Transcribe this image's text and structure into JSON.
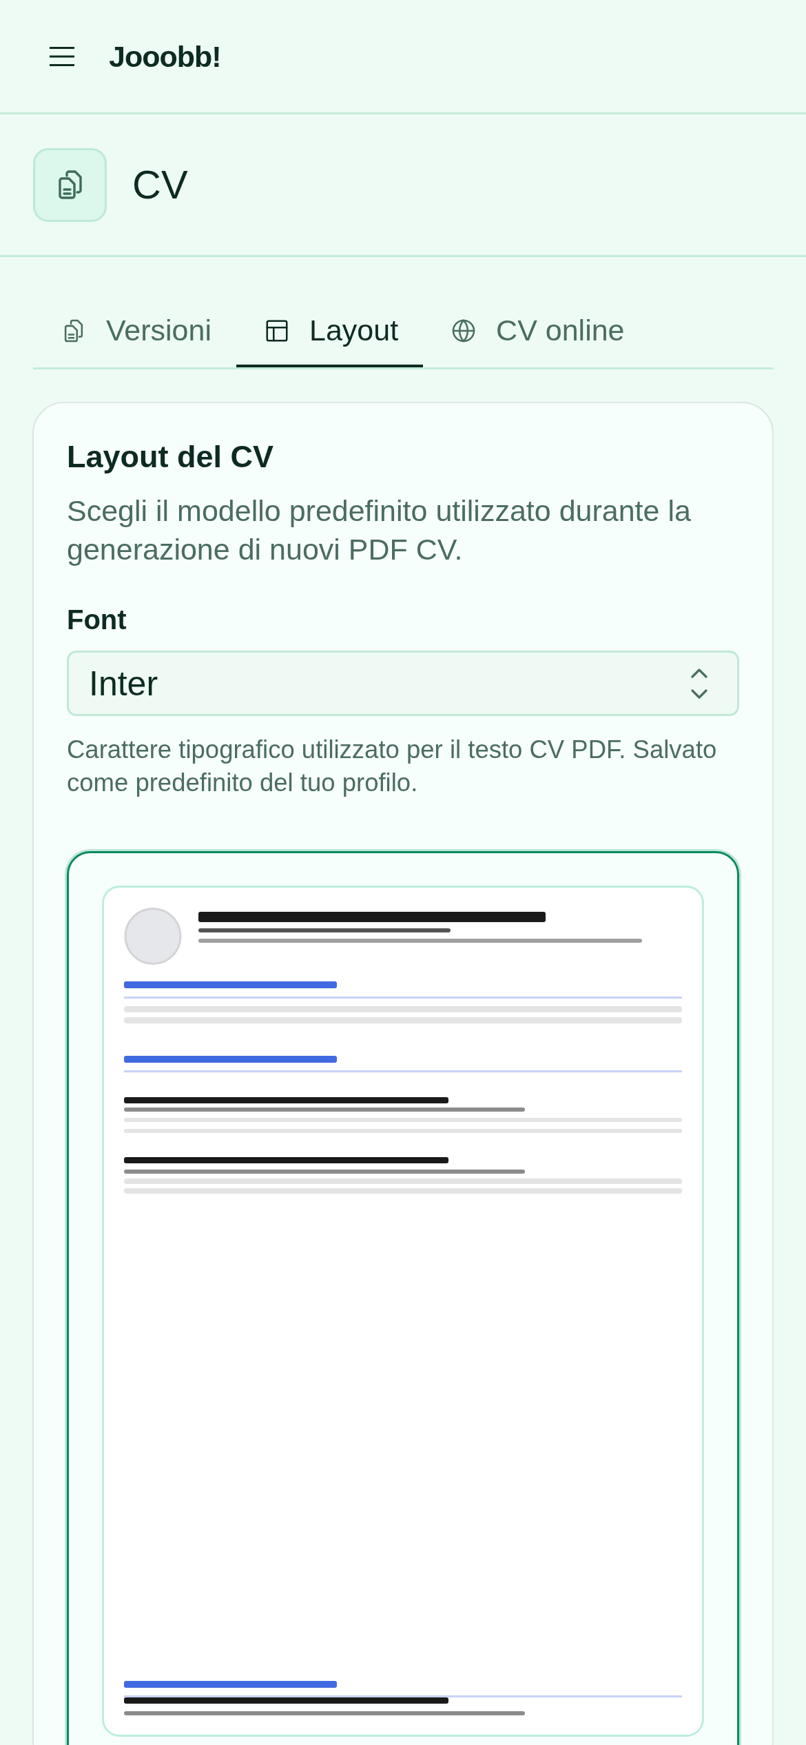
{
  "app_bar": {
    "title": "Jooobb!"
  },
  "page_header": {
    "title": "CV"
  },
  "tabs": [
    {
      "label": "Versioni",
      "selected": false
    },
    {
      "label": "Layout",
      "selected": true
    },
    {
      "label": "CV online",
      "selected": false
    }
  ],
  "layout_card": {
    "title": "Layout del CV",
    "description": "Scegli il modello predefinito utilizzato durante la generazione di nuovi PDF CV.",
    "font_field": {
      "label": "Font",
      "value": "Inter",
      "help": "Carattere tipografico utilizzato per il testo CV PDF. Salvato come predefinito del tuo profilo."
    },
    "templates": [
      {
        "selected": true
      }
    ]
  }
}
